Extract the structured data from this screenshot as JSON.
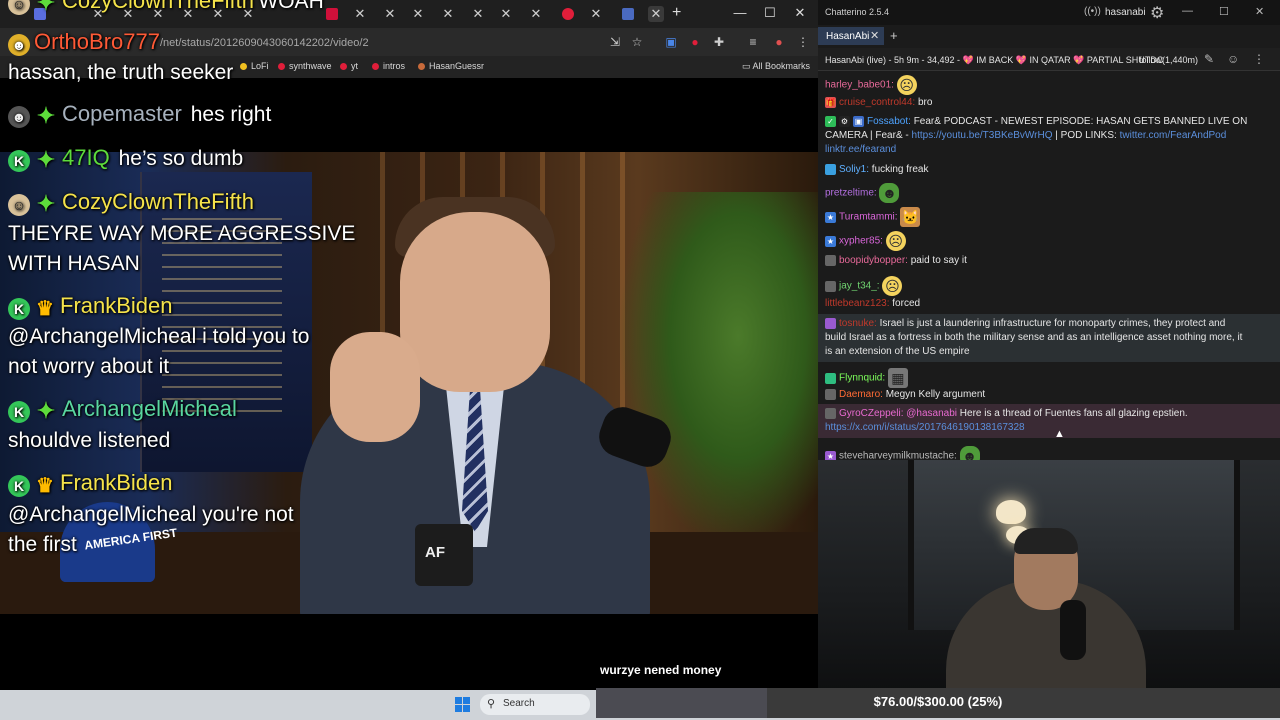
{
  "browser": {
    "url": "/net/status/2012609043060142202/video/2",
    "bookmarks": [
      "LoFi",
      "synthwave",
      "yt",
      "intros",
      "HasanGuessr"
    ],
    "all_bookmarks": "All Bookmarks"
  },
  "video": {
    "subtitle": "wurzye nened money",
    "mug_label": "AF",
    "hat_text": "AMERICA FIRST"
  },
  "overlay": {
    "top_partial": {
      "name": "CozyClownTheFifth",
      "msg": "WOAH"
    },
    "messages": [
      {
        "name": "OrthoBro777",
        "name_color": "#ff5a36",
        "text": "hassan, the truth seeker"
      },
      {
        "name": "Copemaster",
        "name_color": "#a6b1bd",
        "text": "hes right"
      },
      {
        "name": "47IQ",
        "name_color": "#5ddc3b",
        "text": "he’s so dumb"
      },
      {
        "name": "CozyClownTheFifth",
        "name_color": "#f5e34a",
        "text": "THEYRE WAY MORE AGGRESSIVE",
        "text2": "WITH HASAN"
      },
      {
        "name": "FrankBiden",
        "name_color": "#f5e34a",
        "text": "@ArchangelMicheal i told you to",
        "text2": "not worry about it"
      },
      {
        "name": "ArchangelMicheal",
        "name_color": "#59d6a0",
        "text": "shouldve listened"
      },
      {
        "name": "FrankBiden",
        "name_color": "#f5e34a",
        "text": "@ArchangelMicheal you're not",
        "text2": "the first"
      }
    ]
  },
  "chatterino": {
    "title": "Chatterino 2.5.4",
    "user": "hasanabi",
    "tab": "HasanAbi",
    "split_title": "HasanAbi (live) - 5h 9m - 34,492 - 💖 IM BACK 💖 IN QATAR 💖 PARTIAL SHUTDC",
    "follow": "follow(1,440m)",
    "messages": [
      {
        "user": "harley_babe01:",
        "color": "#e86a9a",
        "text": ""
      },
      {
        "user": "cruise_control44:",
        "color": "#c0392b",
        "text": "bro"
      },
      {
        "user": "Fossabot:",
        "color": "#4da3ff",
        "text": "Fear& PODCAST - NEWEST EPISODE: HASAN GETS BANNED LIVE ON",
        "text2": "CAMERA | Fear& -",
        "link1": "https://youtu.be/T3BKeBvWrHQ",
        "text3": "| POD LINKS:",
        "link2": "twitter.com/FearAndPod",
        "link3": "linktr.ee/fearand"
      },
      {
        "user": "Soliy1:",
        "color": "#5fb0ff",
        "text": "fucking freak"
      },
      {
        "user": "pretzeltime:",
        "color": "#b36fe0",
        "text": ""
      },
      {
        "user": "Turamtammi:",
        "color": "#d966d9",
        "text": ""
      },
      {
        "user": "xypher85:",
        "color": "#d966d9",
        "text": ""
      },
      {
        "user": "boopidybopper:",
        "color": "#e86a9a",
        "text": "paid to say it"
      },
      {
        "user": "jay_t34_:",
        "color": "#6fd26f",
        "text": ""
      },
      {
        "user": "littlebeanz123:",
        "color": "#c0392b",
        "text": "forced"
      },
      {
        "user": "tosnuke:",
        "color": "#c0392b",
        "text": "Israel is just a laundering infrastructure for monoparty crimes, they protect and",
        "text2": "build Israel as a fortress in both the military sense and as an intelligence asset nothing more, it",
        "text3": "is an extension of the US empire"
      },
      {
        "user": "Flynnquid:",
        "color": "#7cfc5a",
        "text": ""
      },
      {
        "user": "Daemaro:",
        "color": "#ff6b35",
        "text": "Megyn Kelly argument"
      },
      {
        "user": "GyroCZeppeli:",
        "color": "#e86ad0",
        "mention": "@hasanabi",
        "text": "Here is a thread of Fuentes fans all glazing epstien.",
        "link1": "https://x.com/i/status/2017646190138167328"
      },
      {
        "user": "steveharveymilkmustache:",
        "color": "#bbbbbb",
        "text": ""
      }
    ]
  },
  "taskbar": {
    "search": "Search"
  },
  "goal": {
    "text": "$76.00/$300.00 (25%)",
    "fraction": 0.25
  }
}
